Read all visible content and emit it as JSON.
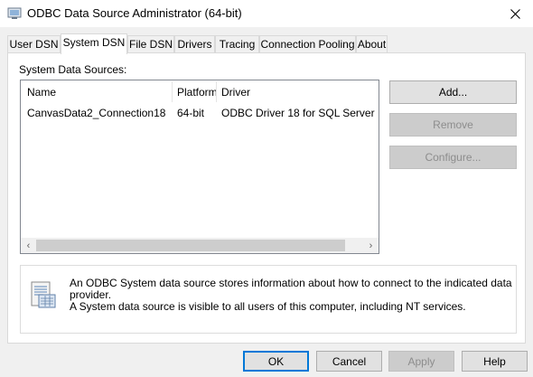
{
  "window": {
    "title": "ODBC Data Source Administrator (64-bit)",
    "icon": "odbc-admin-icon",
    "close_glyph": "✕"
  },
  "tabs": [
    {
      "label": "User DSN",
      "active": false
    },
    {
      "label": "System DSN",
      "active": true
    },
    {
      "label": "File DSN",
      "active": false
    },
    {
      "label": "Drivers",
      "active": false
    },
    {
      "label": "Tracing",
      "active": false
    },
    {
      "label": "Connection Pooling",
      "active": false
    },
    {
      "label": "About",
      "active": false
    }
  ],
  "system_dsn": {
    "section_label": "System Data Sources:",
    "columns": [
      "Name",
      "Platform",
      "Driver"
    ],
    "rows": [
      [
        "CanvasData2_Connection18",
        "64-bit",
        "ODBC Driver 18 for SQL Server"
      ]
    ],
    "scroll_left": "‹",
    "scroll_right": "›",
    "buttons": {
      "add": "Add...",
      "remove": "Remove",
      "configure": "Configure..."
    },
    "info_line1": "An ODBC System data source stores information about how to connect to the indicated data provider.",
    "info_line2": "A System data source is visible to all users of this computer, including NT services."
  },
  "footer": {
    "ok": "OK",
    "cancel": "Cancel",
    "apply": "Apply",
    "help": "Help"
  },
  "colors": {
    "accent": "#0078d7",
    "disabled_text": "#8d8d8d"
  }
}
